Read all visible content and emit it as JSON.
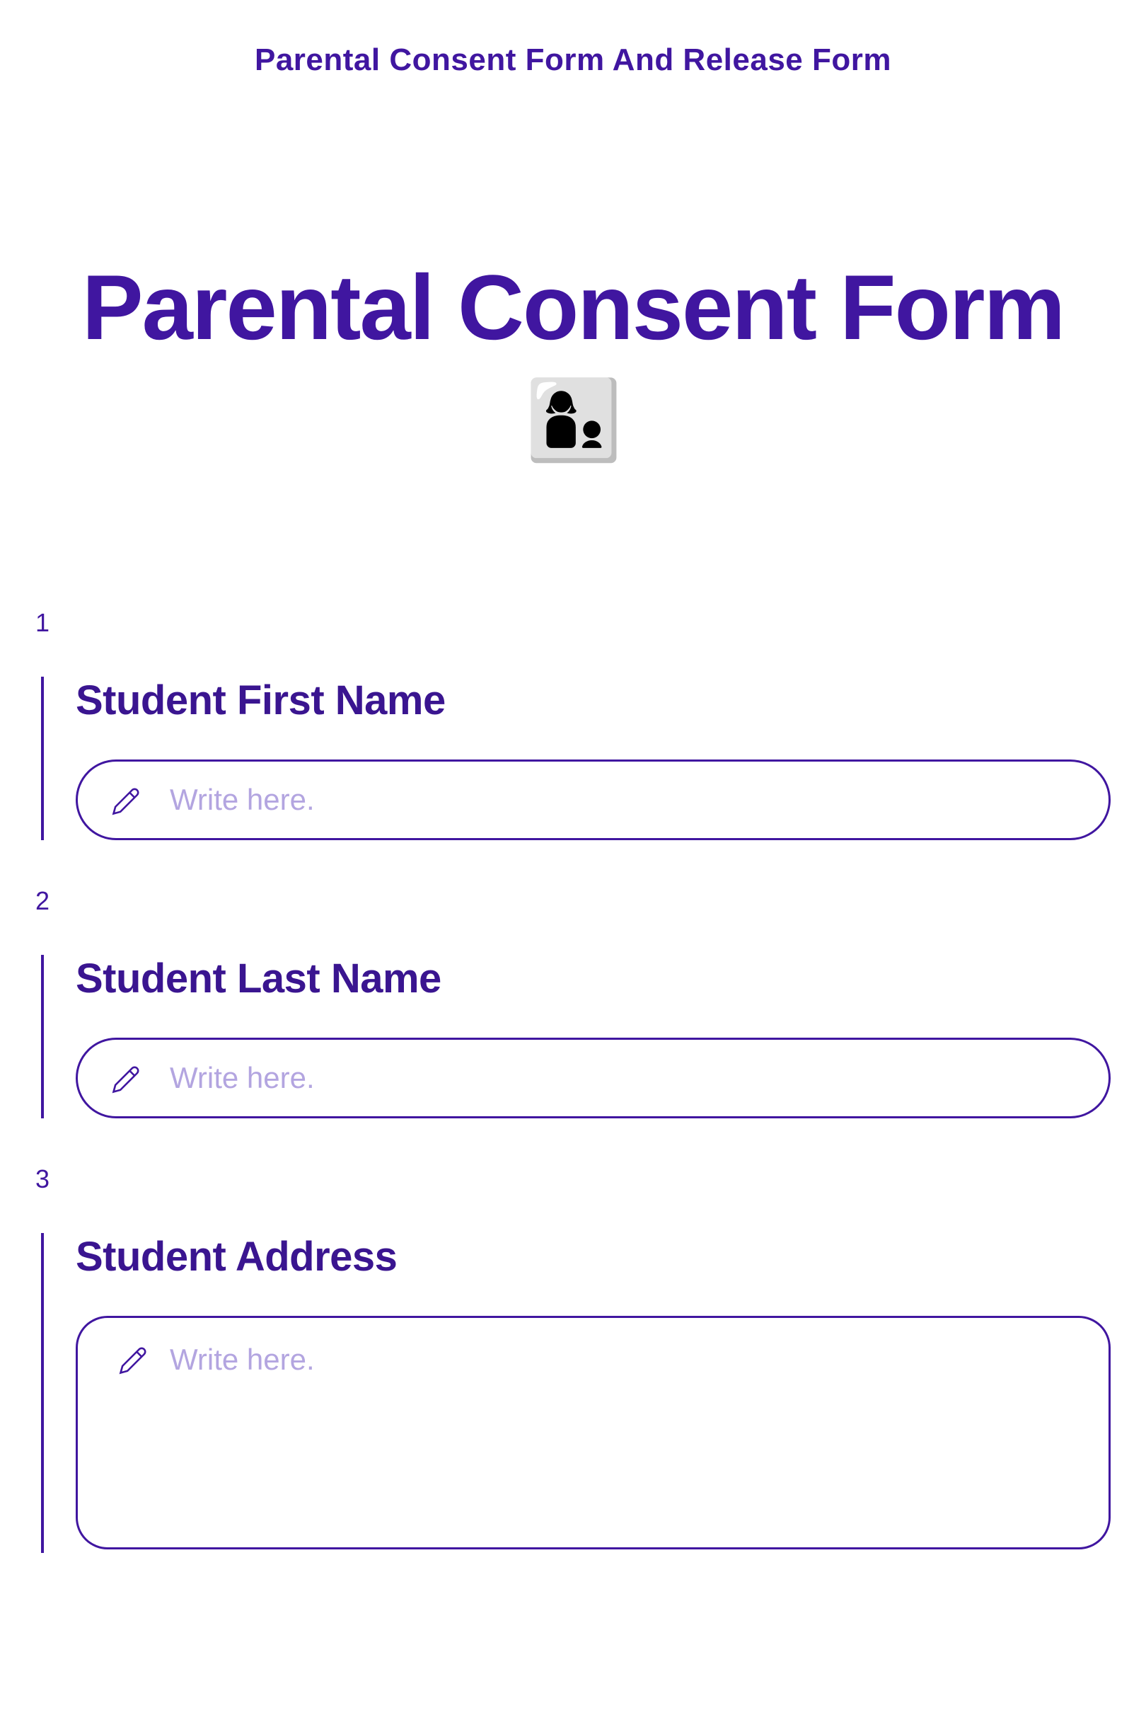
{
  "header": {
    "title": "Parental Consent Form And Release Form"
  },
  "main": {
    "title_text": "Parental Consent Form ",
    "title_emoji": "👩‍👦"
  },
  "questions": [
    {
      "number": "1",
      "label": "Student First Name",
      "placeholder": "Write here.",
      "type": "text"
    },
    {
      "number": "2",
      "label": "Student Last Name",
      "placeholder": "Write here.",
      "type": "text"
    },
    {
      "number": "3",
      "label": "Student Address",
      "placeholder": "Write here.",
      "type": "textarea"
    }
  ]
}
